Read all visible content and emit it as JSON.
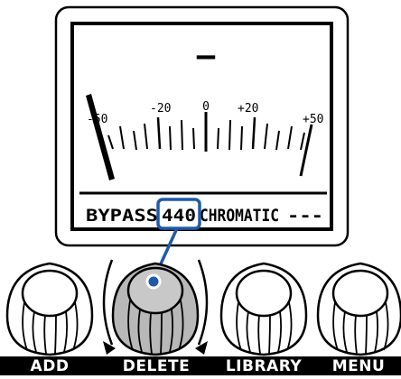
{
  "display": {
    "note": "–",
    "scale_labels": [
      "-50",
      "-20",
      "0",
      "+20",
      "+50"
    ],
    "bypass_label": "BYPASS",
    "calibration": "440",
    "tuner_type": "CHROMATIC",
    "status": "---"
  },
  "knobs": [
    {
      "label": "ADD"
    },
    {
      "label": "DELETE",
      "selected": true
    },
    {
      "label": "LIBRARY"
    },
    {
      "label": "MENU"
    }
  ],
  "colors": {
    "highlight": "#1f5aa8",
    "selected_knob": "#b8b8b8",
    "label_bar": "#000000"
  }
}
